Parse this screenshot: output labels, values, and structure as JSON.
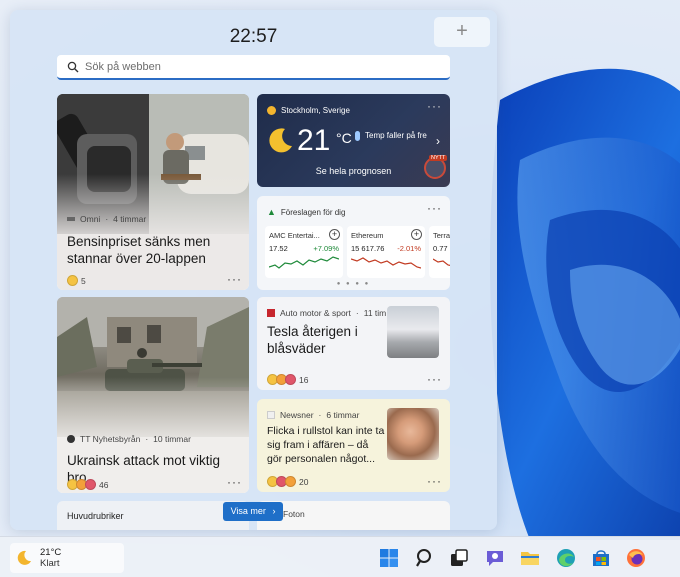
{
  "panel": {
    "clock": "22:57",
    "add_label": "+",
    "search": {
      "placeholder": "Sök på webben"
    }
  },
  "cards": {
    "fuel": {
      "source": "Omni",
      "time": "4 timmar",
      "headline": "Bensinpriset sänks men stannar över 20-lappen",
      "reaction_count": "5",
      "more": "···"
    },
    "weather": {
      "location": "Stockholm, Sverige",
      "temp": "21",
      "unit": "°C",
      "condition": "Temp faller på fre",
      "badge": "NYTT",
      "forecast_link": "Se hela prognosen",
      "more": "···"
    },
    "stocks": {
      "title": "Föreslagen för dig",
      "more": "···",
      "items": [
        {
          "name": "AMC Entertai...",
          "price": "17.52",
          "change": "+7.09%",
          "direction": "up"
        },
        {
          "name": "Ethereum",
          "price": "15 617.76",
          "change": "-2.01%",
          "direction": "down"
        },
        {
          "name": "Terra",
          "price": "0.77",
          "change": "",
          "direction": "down"
        }
      ],
      "add_label": "+",
      "pager": "● ● ● ●"
    },
    "tesla": {
      "source": "Auto motor & sport",
      "time": "11 tim",
      "headline": "Tesla återigen i blåsväder",
      "reaction_count": "16",
      "more": "···"
    },
    "ukraine": {
      "source": "TT Nyhetsbyrån",
      "time": "10 timmar",
      "headline": "Ukrainsk attack mot viktig bro",
      "reaction_count": "46",
      "more": "···"
    },
    "flicka": {
      "source": "Newsner",
      "time": "6 timmar",
      "headline": "Flicka i rullstol kan inte ta sig fram i affären – då gör personalen något...",
      "reaction_count": "20",
      "more": "···"
    },
    "top_news": {
      "title": "Huvudrubriker"
    },
    "photos": {
      "title": "Foton"
    }
  },
  "visa_mer": "Visa mer",
  "taskbar": {
    "weather_temp": "21°C",
    "weather_condition": "Klart"
  },
  "colors": {
    "accent": "#1f6fc8",
    "positive": "#1f8a3a",
    "negative": "#c23b22"
  }
}
